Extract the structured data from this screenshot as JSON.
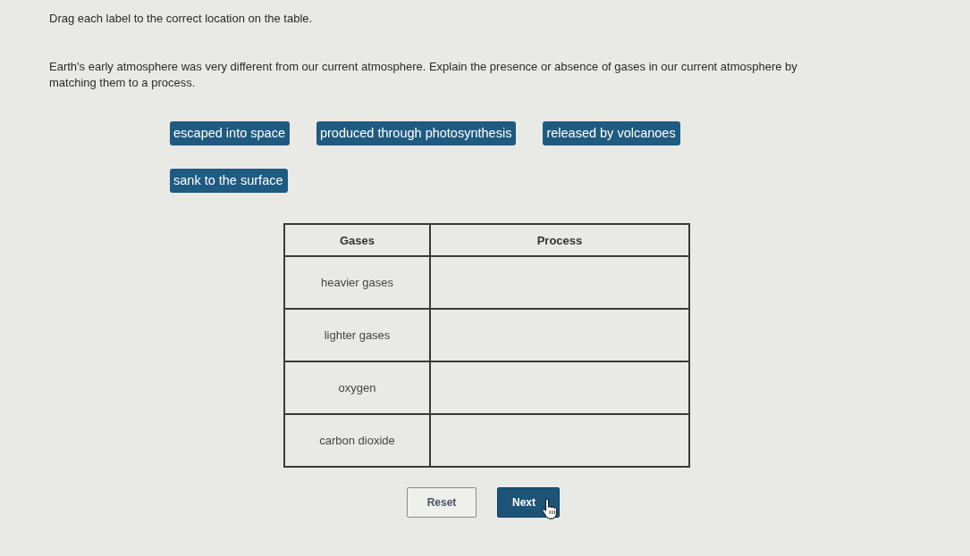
{
  "instruction": "Drag each label to the correct location on the table.",
  "question": "Earth's early atmosphere was very different from our current atmosphere. Explain the presence or absence of gases in our current atmosphere by matching them to a process.",
  "labels": [
    "escaped into space",
    "produced through photosynthesis",
    "released by volcanoes",
    "sank to the surface"
  ],
  "table": {
    "columns": [
      "Gases",
      "Process"
    ],
    "rows": [
      "heavier gases",
      "lighter gases",
      "oxygen",
      "carbon dioxide"
    ]
  },
  "buttons": [
    {
      "label": "Reset",
      "kind": "secondary"
    },
    {
      "label": "Next",
      "kind": "primary"
    }
  ]
}
